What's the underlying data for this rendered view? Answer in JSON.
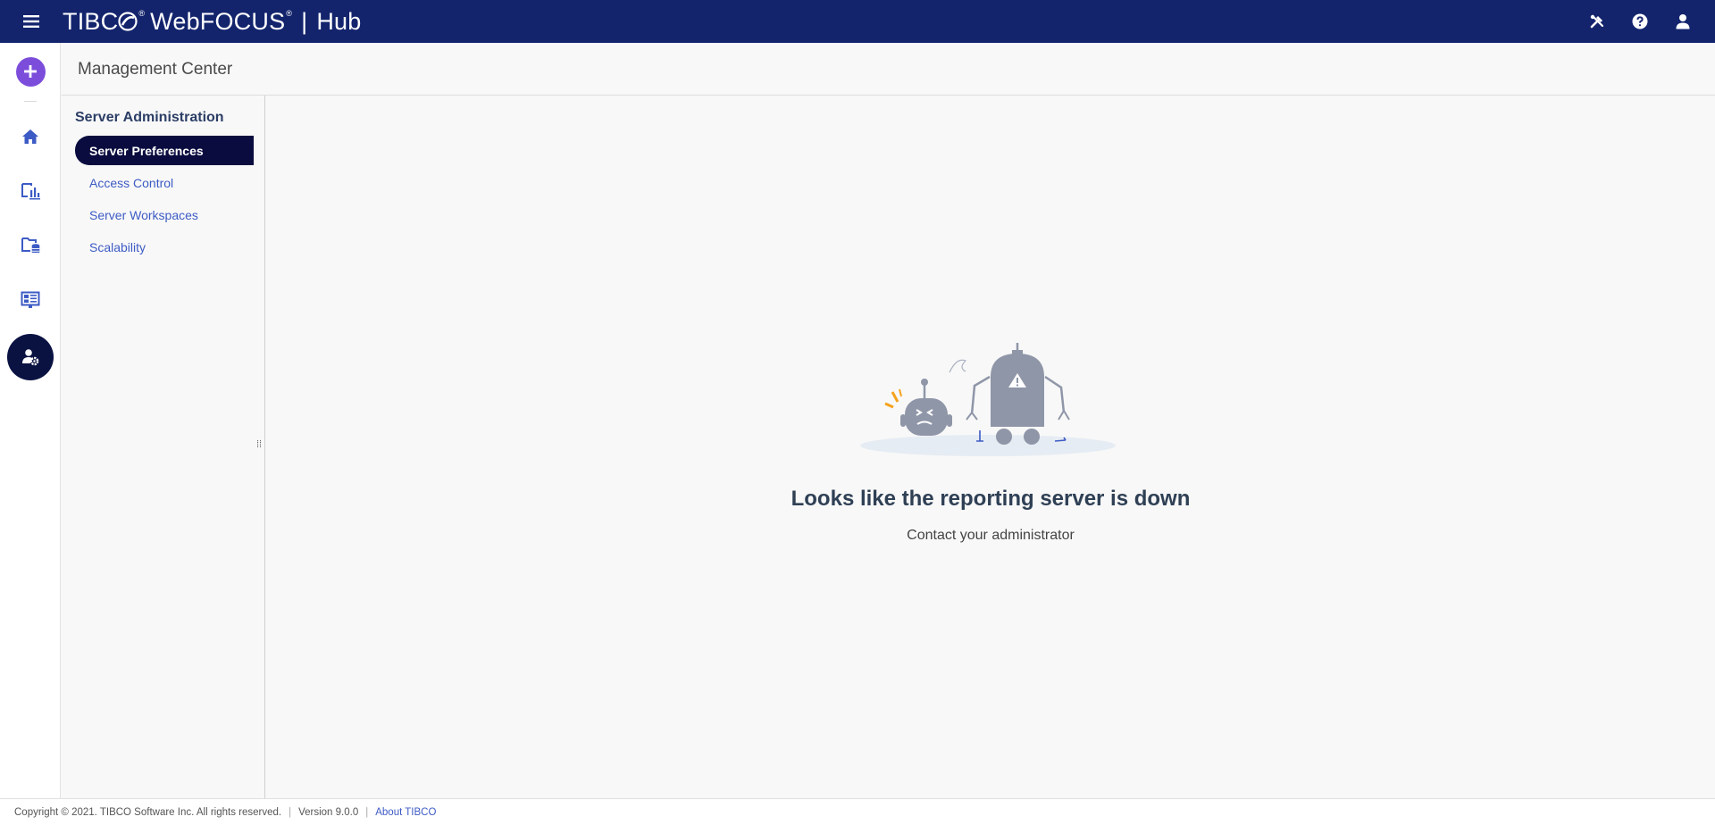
{
  "header": {
    "brand_tibco": "TIBC",
    "brand_product": "WebFOCUS",
    "brand_reg": "®",
    "brand_separator": "|",
    "brand_hub": "Hub",
    "icons": [
      "menu-icon",
      "tools-icon",
      "help-icon",
      "user-icon"
    ]
  },
  "rail": {
    "items": [
      "plus-icon",
      "home-icon",
      "workspaces-chart-icon",
      "data-folder-icon",
      "portal-icon",
      "admin-user-gear-icon"
    ],
    "active": "admin-user-gear-icon"
  },
  "page": {
    "title": "Management Center"
  },
  "subnav": {
    "section_title": "Server Administration",
    "items": [
      {
        "label": "Server Preferences",
        "active": true
      },
      {
        "label": "Access Control",
        "active": false
      },
      {
        "label": "Server Workspaces",
        "active": false
      },
      {
        "label": "Scalability",
        "active": false
      }
    ],
    "grip": "⁞⁞"
  },
  "error": {
    "title": "Looks like the reporting server is down",
    "subtitle": "Contact your administrator"
  },
  "footer": {
    "copyright": "Copyright © 2021. TIBCO Software Inc. All rights reserved.",
    "version": "Version 9.0.0",
    "about_link": "About TIBCO",
    "separator": "|"
  },
  "colors": {
    "topbar": "#13246d",
    "accent_purple": "#7c4ddb",
    "active_nav": "#0a0c3f",
    "link_blue": "#3d5bc4"
  }
}
